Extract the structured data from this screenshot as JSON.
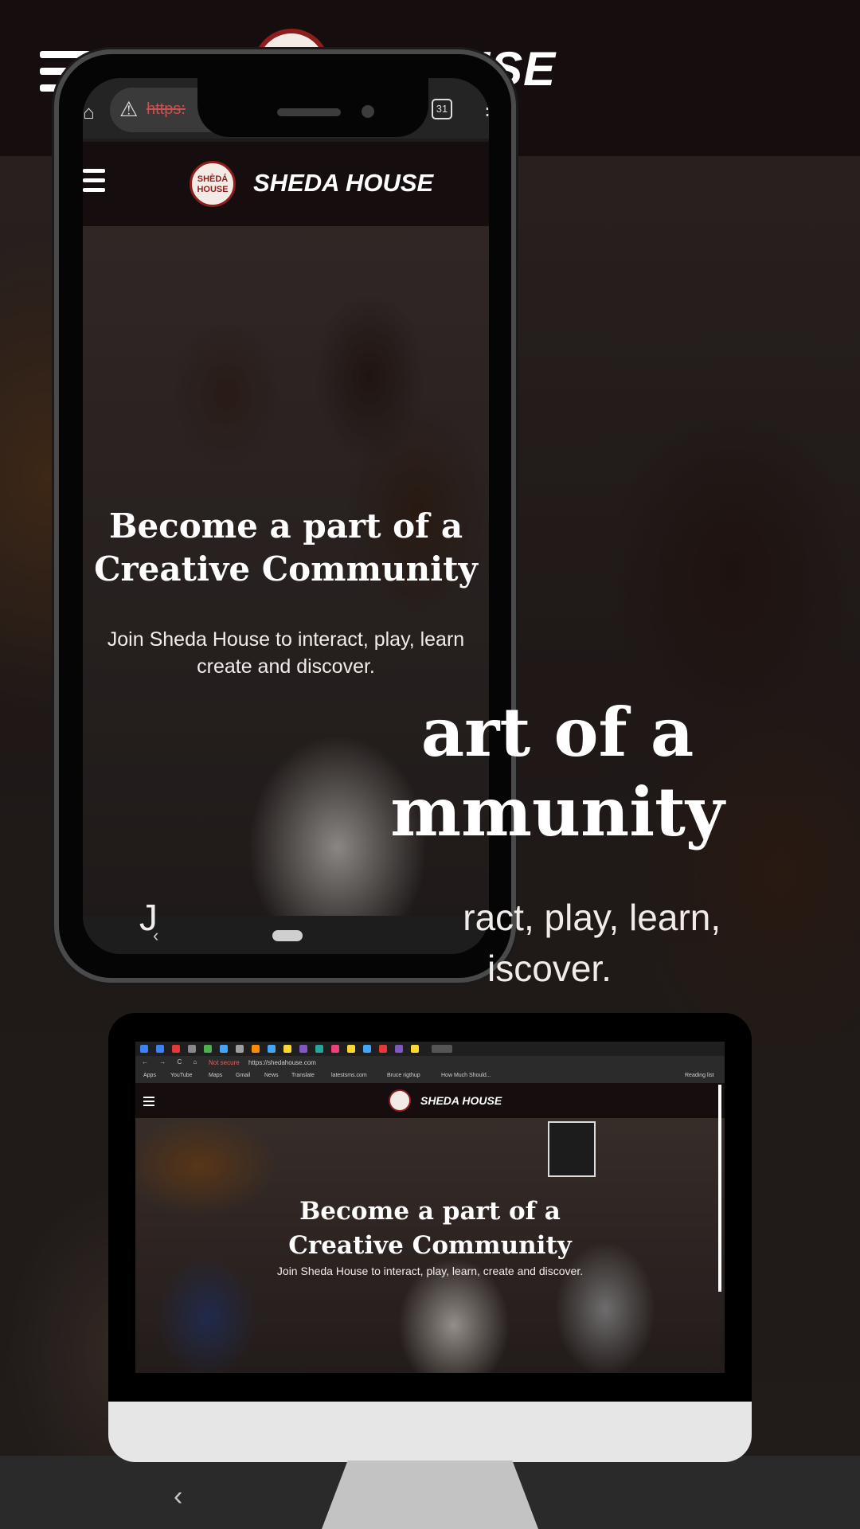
{
  "site": {
    "brand": "SHEDA HOUSE",
    "brand_partial": "A HOUSE",
    "logo_text_line1": "SHÈDÁ",
    "logo_text_line2": "HOUSE",
    "hero_title_line1": "Become a part of a",
    "hero_title_line2": "Creative Community",
    "hero_subtitle": "Join Sheda House to interact, play, learn, create and discover.",
    "mobile_subtitle_line1": "Join Sheda House to interact, play, learn",
    "mobile_subtitle_line2": "create and discover.",
    "bg_title_line1": "art of a",
    "bg_title_line2": "mmunity",
    "bg_sub_line1": "J                              ract, play, learn,",
    "bg_sub_line2": "iscover."
  },
  "phone_browser": {
    "url_fragment": "https:",
    "tab_count": "31",
    "warning_icon": "⚠",
    "more_icon": "⋮",
    "home_icon": "⌂"
  },
  "desktop_browser": {
    "not_secure": "Not secure",
    "url": "https://shedahouse.com",
    "nav_icons": "← → C ⌂",
    "bookmarks": [
      "Apps",
      "YouTube",
      "Maps",
      "Gmail",
      "News",
      "Translate",
      "latestsms.com",
      "Bruce rigthup",
      "How Much Should..."
    ],
    "reading_list": "Reading list"
  },
  "system_nav": {
    "back_icon": "‹"
  },
  "colors": {
    "header_bg": "#150d0e",
    "logo_ring": "#8e1e1e",
    "insecure_red": "#c95050"
  }
}
